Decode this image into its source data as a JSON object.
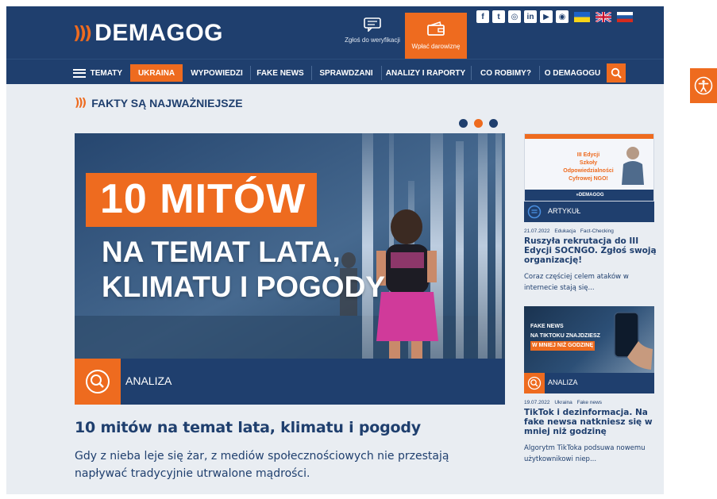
{
  "logo": {
    "waves": ")))",
    "text": "DEMAGOG"
  },
  "header": {
    "report_label": "Zgłoś do weryfikacji",
    "donate_label": "Wpłać darowiznę",
    "socials": [
      {
        "icon": "facebook-icon",
        "glyph": "f"
      },
      {
        "icon": "twitter-icon",
        "glyph": "t"
      },
      {
        "icon": "instagram-icon",
        "glyph": "◎"
      },
      {
        "icon": "linkedin-icon",
        "glyph": "in"
      },
      {
        "icon": "youtube-icon",
        "glyph": "▶"
      },
      {
        "icon": "rss-icon",
        "glyph": "◉"
      }
    ]
  },
  "nav": {
    "items": [
      {
        "label": "TEMATY"
      },
      {
        "label": "UKRAINA"
      },
      {
        "label": "WYPOWIEDZI"
      },
      {
        "label": "FAKE NEWS"
      },
      {
        "label": "SPRAWDZANI"
      },
      {
        "label": "ANALIZY I RAPORTY"
      },
      {
        "label": "CO ROBIMY?"
      },
      {
        "label": "O DEMAGOGU"
      }
    ]
  },
  "section": {
    "waves": ")))",
    "title": "FAKTY SĄ NAJWAŻNIEJSZE"
  },
  "hero": {
    "title": "10 MITÓW",
    "subtitle_line1": "NA TEMAT LATA,",
    "subtitle_line2": "KLIMATU I POGODY",
    "label": "ANALIZA"
  },
  "main": {
    "title": "10 mitów na temat lata, klimatu i pogody",
    "desc": "Gdy z nieba leje się żar, z mediów społecznościowych nie przestają napływać tradycyjnie utrwalone mądrości."
  },
  "cards": [
    {
      "img_text1": "III Edycji",
      "img_text2": "Szkoły Odpowiedzialności",
      "img_text3": "Cyfrowej NGO!",
      "img_footer": "»DEMAGOG",
      "label": "ARTYKUŁ",
      "meta": [
        "21.07.2022",
        "Edukacja",
        "Fact-Checking"
      ],
      "title": "Ruszyła rekrutacja do III Edycji SOCNGO. Zgłoś swoją organizację!",
      "desc": "Coraz częściej celem ataków w internecie stają się..."
    },
    {
      "img_text1": "FAKE NEWS",
      "img_text2": "NA TIKTOKU ZNAJDZIESZ",
      "img_text3": "W MNIEJ NIŻ GODZINĘ",
      "label": "ANALIZA",
      "meta": [
        "19.07.2022",
        "Ukraina",
        "Fake news"
      ],
      "title": "TikTok i dezinformacja. Na fake newsa natkniesz się w mniej niż godzinę",
      "desc": "Algorytm TikToka podsuwa nowemu użytkownikowi niep..."
    }
  ],
  "colors": {
    "navy": "#1f3f6e",
    "orange": "#ee6b1f",
    "bg": "#e9edf2"
  }
}
